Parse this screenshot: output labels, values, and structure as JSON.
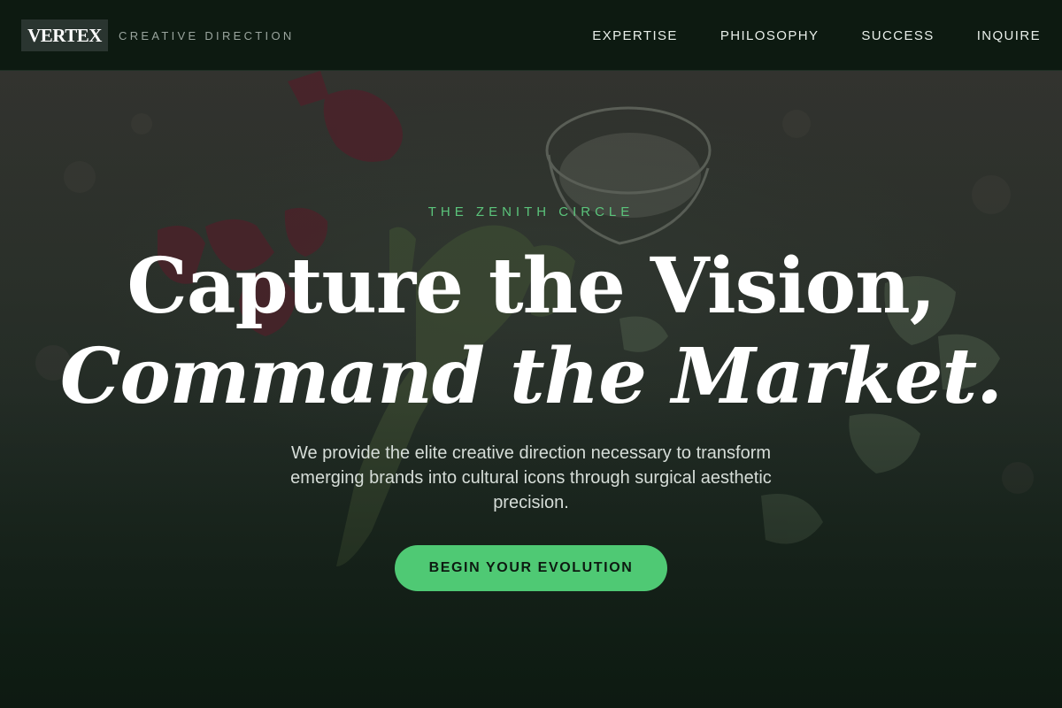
{
  "header": {
    "logo": "VERTEX",
    "tagline": "CREATIVE DIRECTION",
    "nav": [
      {
        "label": "EXPERTISE"
      },
      {
        "label": "PHILOSOPHY"
      },
      {
        "label": "SUCCESS"
      },
      {
        "label": "INQUIRE"
      }
    ]
  },
  "hero": {
    "eyebrow": "THE ZENITH CIRCLE",
    "headline_line1": "Capture the Vision,",
    "headline_line2": "Command the Market.",
    "subtext": "We provide the elite creative direction necessary to transform emerging brands into cultural icons through surgical aesthetic precision.",
    "cta_label": "BEGIN YOUR EVOLUTION"
  },
  "colors": {
    "header_bg": "#0d1a11",
    "accent": "#4fc974",
    "eyebrow": "#5bc47b",
    "headline": "#ffffff",
    "subtext": "#d6ddd8"
  }
}
